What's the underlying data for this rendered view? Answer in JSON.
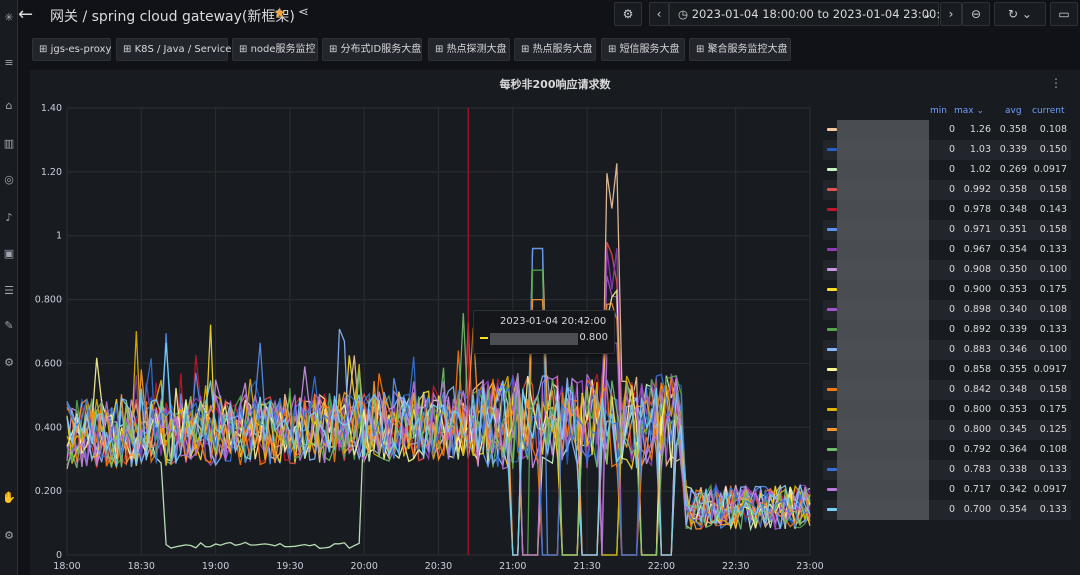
{
  "header": {
    "breadcrumb": "网关 / spring cloud gateway(新框架)",
    "time_range": "2023-01-04 18:00:00 to 2023-01-04 23:00:00",
    "icons": [
      "back-arrow-icon",
      "star-icon",
      "share-icon",
      "settings-icon",
      "chevron-left-icon",
      "clock-icon",
      "chevron-down-icon",
      "chevron-right-icon",
      "zoom-out-icon",
      "refresh-icon",
      "tv-icon"
    ]
  },
  "dashboard_links": [
    "jgs-es-proxy",
    "K8S / Java / Service",
    "node服务监控",
    "分布式ID服务大盘",
    "热点探测大盘",
    "热点服务大盘",
    "短信服务大盘",
    "聚合服务监控大盘"
  ],
  "panel": {
    "title": "每秒非200响应请求数"
  },
  "legend": {
    "headers": {
      "min": "min",
      "max": "max",
      "avg": "avg",
      "current": "current"
    },
    "rows": [
      {
        "color": "#f2c6a0",
        "min": "0",
        "max": "1.26",
        "avg": "0.358",
        "current": "0.108"
      },
      {
        "color": "#1f60c4",
        "min": "0",
        "max": "1.03",
        "avg": "0.339",
        "current": "0.150"
      },
      {
        "color": "#c8f2c2",
        "min": "0",
        "max": "1.02",
        "avg": "0.269",
        "current": "0.0917"
      },
      {
        "color": "#e0524e",
        "min": "0",
        "max": "0.992",
        "avg": "0.358",
        "current": "0.158"
      },
      {
        "color": "#c4162a",
        "min": "0",
        "max": "0.978",
        "avg": "0.348",
        "current": "0.143"
      },
      {
        "color": "#5794f2",
        "min": "0",
        "max": "0.971",
        "avg": "0.351",
        "current": "0.158"
      },
      {
        "color": "#8f3bb8",
        "min": "0",
        "max": "0.967",
        "avg": "0.354",
        "current": "0.133"
      },
      {
        "color": "#ca95e5",
        "min": "0",
        "max": "0.908",
        "avg": "0.350",
        "current": "0.100"
      },
      {
        "color": "#fade2a",
        "min": "0",
        "max": "0.900",
        "avg": "0.353",
        "current": "0.175"
      },
      {
        "color": "#a352cc",
        "min": "0",
        "max": "0.898",
        "avg": "0.340",
        "current": "0.108"
      },
      {
        "color": "#56a64b",
        "min": "0",
        "max": "0.892",
        "avg": "0.339",
        "current": "0.133"
      },
      {
        "color": "#8ab8ff",
        "min": "0",
        "max": "0.883",
        "avg": "0.346",
        "current": "0.100"
      },
      {
        "color": "#fff899",
        "min": "0",
        "max": "0.858",
        "avg": "0.355",
        "current": "0.0917"
      },
      {
        "color": "#ff780a",
        "min": "0",
        "max": "0.842",
        "avg": "0.348",
        "current": "0.158"
      },
      {
        "color": "#e0b400",
        "min": "0",
        "max": "0.800",
        "avg": "0.353",
        "current": "0.175"
      },
      {
        "color": "#ff9830",
        "min": "0",
        "max": "0.800",
        "avg": "0.345",
        "current": "0.125"
      },
      {
        "color": "#73bf69",
        "min": "0",
        "max": "0.792",
        "avg": "0.364",
        "current": "0.108"
      },
      {
        "color": "#3274d9",
        "min": "0",
        "max": "0.783",
        "avg": "0.338",
        "current": "0.133"
      },
      {
        "color": "#b877d9",
        "min": "0",
        "max": "0.717",
        "avg": "0.342",
        "current": "0.0917"
      },
      {
        "color": "#73d2f5",
        "min": "0",
        "max": "0.700",
        "avg": "0.354",
        "current": "0.133"
      }
    ]
  },
  "tooltip": {
    "time": "2023-01-04 20:42:00",
    "value": "0.800"
  },
  "chart_data": {
    "type": "line",
    "title": "每秒非200响应请求数",
    "y_ticks": [
      "0",
      "0.200",
      "0.400",
      "0.600",
      "0.800",
      "1",
      "1.20",
      "1.40"
    ],
    "x_ticks": [
      "18:00",
      "18:30",
      "19:00",
      "19:30",
      "20:00",
      "20:30",
      "21:00",
      "21:30",
      "22:00",
      "22:30",
      "23:00"
    ],
    "ylim": [
      0,
      1.4
    ],
    "xlim": [
      "18:00",
      "23:00"
    ],
    "grid": true,
    "cursor_time": "20:42",
    "series_count": 20,
    "series_overview": {
      "baseline_18_00_to_20_45": 0.38,
      "spike_21_10": 0.96,
      "spike_21_40": 1.26,
      "drop_to_zero_window": [
        "21:00",
        "22:05"
      ],
      "after_22_10": 0.15,
      "low_series_18_40_to_20_00": 0.02
    }
  }
}
